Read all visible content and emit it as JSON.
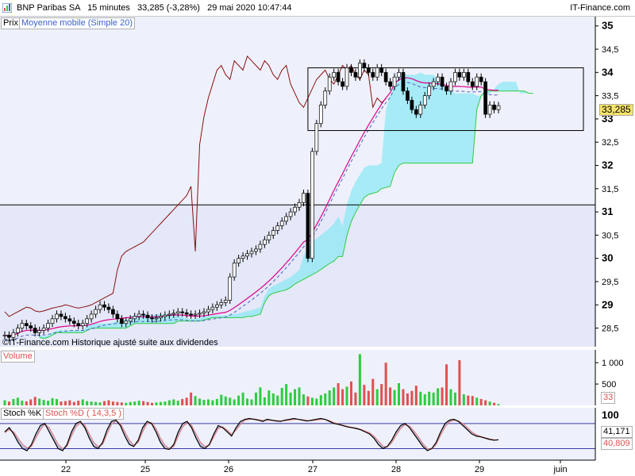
{
  "header": {
    "title": "BNP Paribas SA   15 minutes   33,285 (-3,28%)   29 mai 2020 10:47:44",
    "brand": "IT-Finance.com"
  },
  "legend": {
    "price": "Prix",
    "ma": "Moyenne mobile (Simple 20)",
    "volume": "Volume",
    "stoch_k": "Stoch %K",
    "stoch_d": "Stoch %D ( 14,3,5 )"
  },
  "footnote": "©IT-Finance.com Historique ajusté suite aux dividendes",
  "readouts": {
    "price": "33,285",
    "volume": "33",
    "stoch_k": "41,171",
    "stoch_d": "40,809"
  },
  "colors": {
    "accent": "#3a5fcd",
    "up": "#2ecc40",
    "down": "#e05050",
    "cloud": "#8fe8f5",
    "ma": "#e0008a",
    "lagging": "#8b1010"
  },
  "chart_data": {
    "type": "candlestick",
    "x_tick_labels": [
      "22",
      "25",
      "26",
      "27",
      "28",
      "29",
      "juin"
    ],
    "price_axis": {
      "ticks": [
        "28,5",
        "29",
        "29,5",
        "30",
        "30,5",
        "31",
        "31,5",
        "32",
        "32,5",
        "33",
        "33,5",
        "34",
        "34,5",
        "35"
      ],
      "range": [
        28.1,
        35.2
      ]
    },
    "volume_axis": {
      "ticks": [
        "500",
        "1 000"
      ]
    },
    "stoch_axis": {
      "ticks": [
        "100"
      ]
    },
    "close": [
      28.35,
      28.3,
      28.4,
      28.5,
      28.6,
      28.55,
      28.5,
      28.4,
      28.45,
      28.5,
      28.6,
      28.7,
      28.8,
      28.75,
      28.7,
      28.65,
      28.6,
      28.55,
      28.6,
      28.7,
      28.8,
      28.9,
      29.0,
      28.95,
      28.9,
      28.8,
      28.7,
      28.6,
      28.65,
      28.7,
      28.75,
      28.8,
      28.78,
      28.72,
      28.7,
      28.72,
      28.75,
      28.78,
      28.8,
      28.82,
      28.85,
      28.83,
      28.8,
      28.78,
      28.8,
      28.82,
      28.85,
      28.9,
      28.95,
      29.0,
      29.05,
      29.1,
      29.6,
      29.9,
      30.0,
      30.05,
      30.1,
      30.15,
      30.2,
      30.3,
      30.4,
      30.5,
      30.6,
      30.7,
      30.8,
      30.9,
      31.0,
      31.1,
      31.2,
      31.4,
      30.0,
      32.3,
      32.9,
      33.3,
      33.6,
      33.9,
      34.0,
      33.8,
      33.7,
      34.1,
      34.0,
      33.9,
      34.2,
      34.1,
      34.0,
      33.9,
      34.1,
      34.0,
      33.8,
      33.7,
      33.9,
      34.0,
      33.6,
      33.4,
      33.2,
      33.1,
      33.3,
      33.5,
      33.7,
      33.8,
      33.9,
      33.7,
      33.6,
      33.8,
      34.0,
      33.9,
      34.0,
      33.8,
      33.7,
      33.9,
      33.8,
      33.1,
      33.3,
      33.2,
      33.285
    ],
    "price_box": {
      "y_range": [
        32.75,
        34.1
      ]
    },
    "support_level": 31.15,
    "volume": [
      120,
      90,
      150,
      180,
      110,
      95,
      140,
      200,
      160,
      130,
      110,
      170,
      150,
      90,
      100,
      120,
      80,
      110,
      140,
      100,
      90,
      80,
      70,
      100,
      120,
      90,
      80,
      70,
      60,
      80,
      90,
      110,
      100,
      80,
      60,
      70,
      80,
      90,
      120,
      140,
      110,
      150,
      180,
      300,
      220,
      160,
      130,
      140,
      120,
      150,
      250,
      210,
      180,
      140,
      230,
      300,
      160,
      140,
      300,
      420,
      190,
      350,
      280,
      230,
      410,
      500,
      300,
      380,
      420,
      260,
      210,
      180,
      160,
      240,
      280,
      350,
      420,
      520,
      380,
      440,
      560,
      300,
      1200,
      480,
      340,
      620,
      380,
      500,
      1000,
      420,
      360,
      520,
      380,
      280,
      340,
      460,
      320,
      260,
      320,
      300,
      400,
      420,
      960,
      380,
      300,
      1060,
      260,
      230,
      220,
      180,
      150,
      120,
      90,
      60,
      33
    ],
    "stoch_k": [
      60,
      70,
      55,
      35,
      20,
      15,
      30,
      55,
      75,
      80,
      60,
      40,
      20,
      15,
      30,
      60,
      80,
      85,
      70,
      45,
      25,
      20,
      35,
      65,
      85,
      88,
      75,
      50,
      30,
      25,
      40,
      70,
      85,
      80,
      60,
      35,
      20,
      18,
      30,
      60,
      80,
      85,
      70,
      45,
      25,
      20,
      30,
      55,
      75,
      70,
      60,
      50,
      70,
      85,
      90,
      92,
      90,
      88,
      85,
      90,
      88,
      86,
      85,
      88,
      90,
      92,
      90,
      88,
      86,
      88,
      90,
      92,
      90,
      85,
      80,
      78,
      75,
      72,
      70,
      68,
      65,
      60,
      55,
      45,
      30,
      20,
      25,
      40,
      60,
      75,
      80,
      70,
      55,
      40,
      25,
      15,
      20,
      35,
      60,
      80,
      88,
      90,
      85,
      75,
      65,
      55,
      50,
      48,
      45,
      42,
      40,
      41.171
    ],
    "stoch_d": [
      58,
      65,
      60,
      45,
      30,
      22,
      25,
      45,
      65,
      78,
      70,
      50,
      30,
      20,
      25,
      50,
      72,
      82,
      76,
      55,
      35,
      25,
      30,
      55,
      78,
      86,
      80,
      60,
      40,
      28,
      35,
      60,
      80,
      82,
      68,
      45,
      28,
      20,
      25,
      50,
      72,
      82,
      76,
      55,
      35,
      25,
      28,
      48,
      68,
      72,
      64,
      54,
      64,
      78,
      88,
      90,
      91,
      89,
      87,
      88,
      88,
      87,
      86,
      87,
      88,
      90,
      90,
      89,
      87,
      87,
      88,
      90,
      90,
      87,
      82,
      79,
      76,
      73,
      71,
      69,
      66,
      62,
      58,
      50,
      38,
      26,
      24,
      34,
      52,
      68,
      77,
      74,
      62,
      48,
      32,
      20,
      19,
      30,
      52,
      72,
      84,
      88,
      86,
      80,
      70,
      60,
      53,
      49,
      46,
      43,
      41,
      40.809
    ]
  }
}
